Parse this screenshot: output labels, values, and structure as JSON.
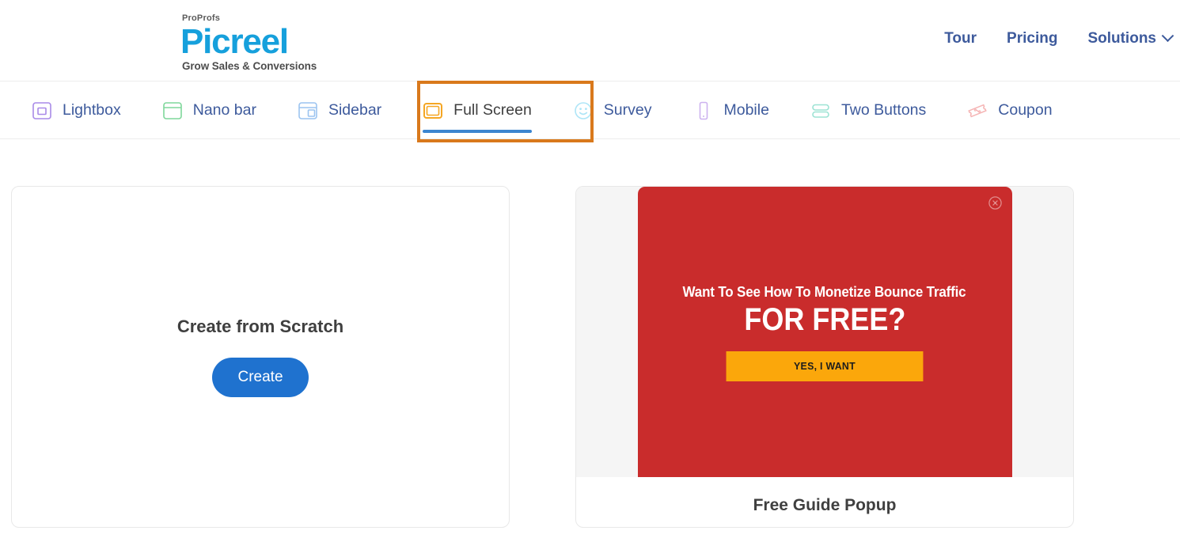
{
  "header": {
    "logo": {
      "top": "ProProfs",
      "main": "Picreel",
      "tagline": "Grow Sales & Conversions",
      "brand_color": "#16a0dc"
    },
    "nav": [
      {
        "label": "Tour",
        "icon": ""
      },
      {
        "label": "Pricing",
        "icon": ""
      },
      {
        "label": "Solutions",
        "icon": "chevron-down-icon"
      }
    ],
    "nav_color": "#3d5a9c"
  },
  "tabs": [
    {
      "label": "Lightbox",
      "icon": "lightbox-icon",
      "color": "#a98ae8",
      "active": false
    },
    {
      "label": "Nano bar",
      "icon": "nano-bar-icon",
      "color": "#7fd79b",
      "active": false
    },
    {
      "label": "Sidebar",
      "icon": "sidebar-icon",
      "color": "#9cc4f0",
      "active": false
    },
    {
      "label": "Full Screen",
      "icon": "full-screen-icon",
      "color": "#f5a623",
      "active": true
    },
    {
      "label": "Survey",
      "icon": "survey-icon",
      "color": "#aee5f7",
      "active": false
    },
    {
      "label": "Mobile",
      "icon": "mobile-icon",
      "color": "#cdb3ef",
      "active": false
    },
    {
      "label": "Two Buttons",
      "icon": "two-buttons-icon",
      "color": "#9de3d4",
      "active": false
    },
    {
      "label": "Coupon",
      "icon": "coupon-icon",
      "color": "#f5b4b4",
      "active": false
    }
  ],
  "active_tab_highlight_color": "#d9791c",
  "active_tab_underline_color": "#3b85d0",
  "main": {
    "scratch_card": {
      "title": "Create from Scratch",
      "button_label": "Create",
      "button_color": "#1f72cf"
    },
    "template_card": {
      "name": "Free Guide Popup",
      "popup": {
        "background_color": "#c92c2c",
        "headline": "Want To See How To Monetize Bounce Traffic",
        "subheadline": "FOR FREE?",
        "cta_label": "YES, I WANT",
        "cta_color": "#fba70b",
        "close_icon": "close-circle-icon"
      }
    }
  }
}
